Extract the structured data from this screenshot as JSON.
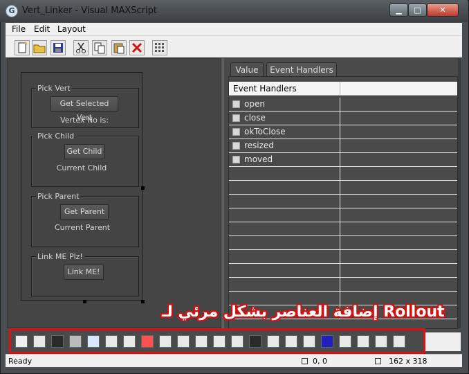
{
  "window": {
    "title": "Vert_Linker - Visual MAXScript",
    "icon_letter": "G"
  },
  "window_buttons": {
    "minimize": "▁",
    "maximize": "□",
    "close": "✕"
  },
  "menu": [
    "File",
    "Edit",
    "Layout"
  ],
  "toolbar_icons": [
    "new-file-icon",
    "open-folder-icon",
    "save-icon",
    "cut-icon",
    "copy-icon",
    "paste-icon",
    "delete-icon",
    "grid-icon"
  ],
  "rollout": {
    "groups": [
      {
        "title": "Pick Vert",
        "button": "Get Selected Vert",
        "label": "Vertex No is:"
      },
      {
        "title": "Pick Child",
        "button": "Get Child",
        "label": "Current Child"
      },
      {
        "title": "Pick Parent",
        "button": "Get Parent",
        "label": "Current Parent"
      },
      {
        "title": "Link ME Plz!",
        "button": "Link ME!",
        "label": ""
      }
    ]
  },
  "tabs": [
    "Value",
    "Event Handlers"
  ],
  "grid": {
    "header": "Event Handlers",
    "rows": [
      "open",
      "close",
      "okToClose",
      "resized",
      "moved"
    ]
  },
  "annotation": "إضافة العناصر بشكل مرئي لـ Rollout",
  "control_icons": [
    "pointer-icon",
    "bitmap-icon",
    "button-icon",
    "mapbutton-icon",
    "materialbutton-icon",
    "pickbutton-icon",
    "checkbutton-icon",
    "colorpicker-icon",
    "combobox-icon",
    "dropdownlist-icon",
    "listbox-icon",
    "edittext-icon",
    "label-icon",
    "groupbox-icon",
    "checkbox-icon",
    "radiobuttons-icon",
    "spinner-icon",
    "progressbar-icon",
    "slider-icon",
    "timer-icon",
    "activex-icon",
    "subrollout-icon"
  ],
  "status": {
    "text": "Ready",
    "position": "0, 0",
    "size": "162 x 318"
  },
  "colors": {
    "annotation_outline": "#e01010",
    "close_button": "#c0392b"
  }
}
